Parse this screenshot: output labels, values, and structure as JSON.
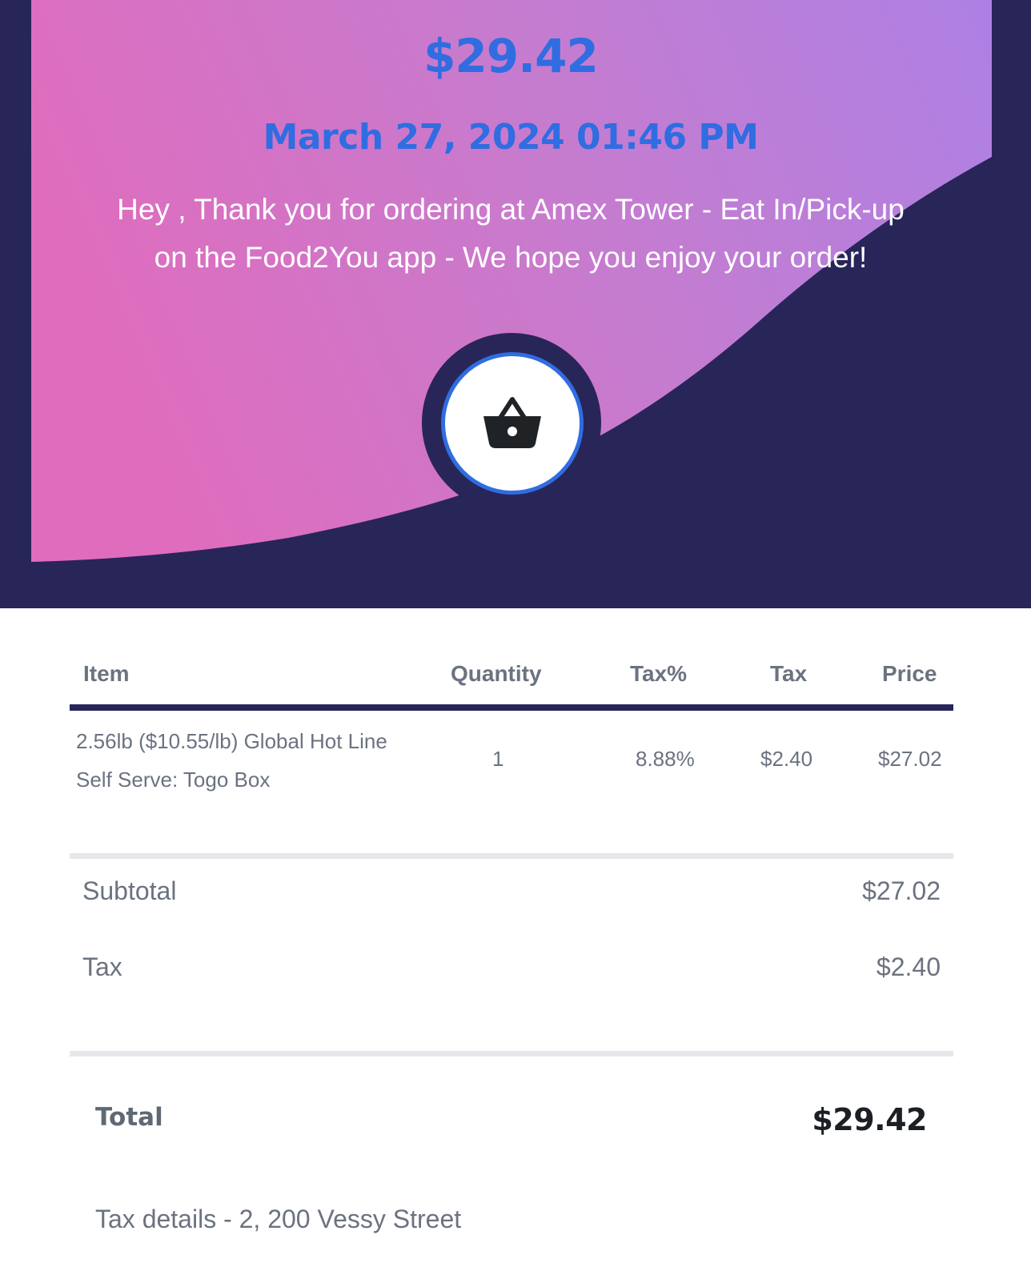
{
  "receipt": {
    "amount": "$29.42",
    "datetime": "March 27, 2024 01:46 PM",
    "thanks_line1": "Hey , Thank you for ordering at Amex Tower - Eat In/Pick-up",
    "thanks_line2": "on the Food2You app - We hope you enjoy your order!"
  },
  "icon": {
    "name": "shopping-basket-icon"
  },
  "table": {
    "headers": {
      "item": "Item",
      "quantity": "Quantity",
      "tax_pct": "Tax%",
      "tax": "Tax",
      "price": "Price"
    },
    "rows": [
      {
        "item_line1": "2.56lb ($10.55/lb) Global Hot Line",
        "item_line2": "Self Serve: Togo Box",
        "quantity": "1",
        "tax_pct": "8.88%",
        "tax": "$2.40",
        "price": "$27.02"
      }
    ]
  },
  "summary": {
    "subtotal_label": "Subtotal",
    "subtotal_value": "$27.02",
    "tax_label": "Tax",
    "tax_value": "$2.40",
    "total_label": "Total",
    "total_value": "$29.42"
  },
  "footer": {
    "tax_details": "Tax details - 2, 200 Vessy Street"
  },
  "colors": {
    "navy": "#282559",
    "accent_blue": "#2f6de1",
    "gradient_start": "#e06cbd",
    "gradient_end": "#af80e3",
    "text_grey": "#6b7280",
    "divider_grey": "#e6e7eb"
  }
}
